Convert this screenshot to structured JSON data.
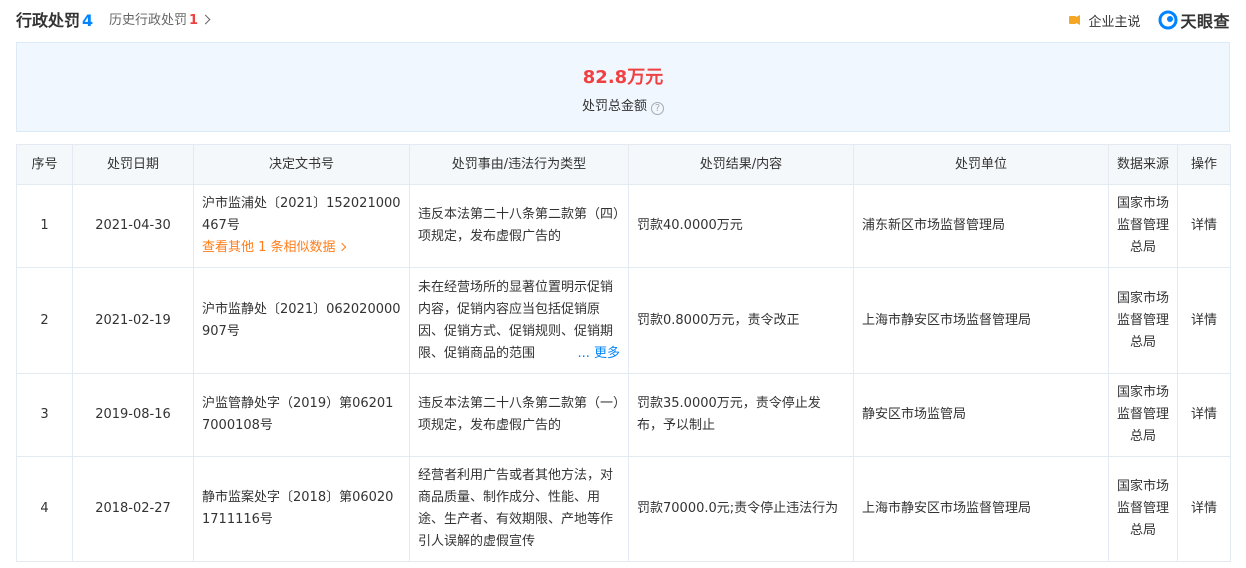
{
  "header": {
    "title": "行政处罚",
    "title_count": "4",
    "history_label": "历史行政处罚",
    "history_count": "1",
    "qiye_label": "企业主说",
    "brand_name": "天眼查"
  },
  "summary": {
    "amount": "82.8万元",
    "label": "处罚总金额"
  },
  "table": {
    "headers": [
      "序号",
      "处罚日期",
      "决定文书号",
      "处罚事由/违法行为类型",
      "处罚结果/内容",
      "处罚单位",
      "数据来源",
      "操作"
    ],
    "rows": [
      {
        "index": "1",
        "date": "2021-04-30",
        "doc_no": "沪市监浦处〔2021〕152021000467号",
        "similar_link": "查看其他 1 条相似数据",
        "reason": "违反本法第二十八条第二款第（四）项规定，发布虚假广告的",
        "result": "罚款40.0000万元",
        "unit": "浦东新区市场监督管理局",
        "source": "国家市场监督管理总局",
        "action": "详情"
      },
      {
        "index": "2",
        "date": "2021-02-19",
        "doc_no": "沪市监静处〔2021〕062020000907号",
        "reason": "未在经营场所的显著位置明示促销内容，促销内容应当包括促销原因、促销方式、促销规则、促销期限、促销商品的范围",
        "more_label": "... 更多",
        "result": "罚款0.8000万元，责令改正",
        "unit": "上海市静安区市场监督管理局",
        "source": "国家市场监督管理总局",
        "action": "详情"
      },
      {
        "index": "3",
        "date": "2019-08-16",
        "doc_no": "沪监管静处字（2019）第062017000108号",
        "reason": "违反本法第二十八条第二款第（一）项规定，发布虚假广告的",
        "result": "罚款35.0000万元，责令停止发布，予以制止",
        "unit": "静安区市场监管局",
        "source": "国家市场监督管理总局",
        "action": "详情"
      },
      {
        "index": "4",
        "date": "2018-02-27",
        "doc_no": "静市监案处字〔2018〕第060201711116号",
        "reason": "经营者利用广告或者其他方法，对商品质量、制作成分、性能、用途、生产者、有效期限、产地等作引人误解的虚假宣传",
        "result": "罚款70000.0元;责令停止违法行为",
        "unit": "上海市静安区市场监督管理局",
        "source": "国家市场监督管理总局",
        "action": "详情"
      }
    ]
  },
  "colors": {
    "accent_blue": "#0084ff",
    "amount_red": "#f04142",
    "link_orange": "#ff7d1a",
    "summary_bg": "#f0f7ff",
    "header_bg": "#f5f8fb"
  },
  "icons": [
    "bulb-icon",
    "tianyancha-logo-icon",
    "question-icon",
    "chevron-right-icon"
  ]
}
